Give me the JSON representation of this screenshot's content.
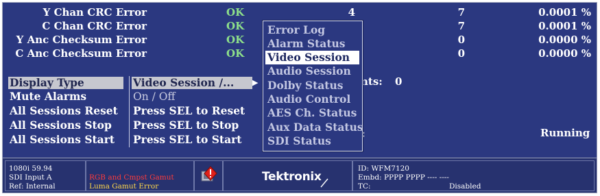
{
  "error_table": {
    "rows": [
      {
        "label": "Y Chan CRC Error",
        "status": "OK",
        "col1": "4",
        "col2": "7",
        "col3": "0.0001 %"
      },
      {
        "label": "C Chan CRC Error",
        "status": "OK",
        "col1": "",
        "col2": "7",
        "col3": "0.0001 %"
      },
      {
        "label": "Y Anc Checksum Error",
        "status": "OK",
        "col1": "",
        "col2": "0",
        "col3": "0.0000 %"
      },
      {
        "label": "C Anc Checksum Error",
        "status": "OK",
        "col1": "",
        "col2": "0",
        "col3": "0.0000 %"
      }
    ]
  },
  "menu": {
    "rows": [
      {
        "name": "Display Type",
        "value": "Video Session /..."
      },
      {
        "name": "Mute Alarms",
        "value": "On / Off"
      },
      {
        "name": "All Sessions Reset",
        "value": "Press SEL to Reset"
      },
      {
        "name": "All Sessions Stop",
        "value": "Press SEL to Stop"
      },
      {
        "name": "All Sessions Start",
        "value": "Press SEL to Start"
      }
    ],
    "submenu_arrow": "▶"
  },
  "popup": {
    "items": [
      "Error Log",
      "Alarm Status",
      "Video Session",
      "Audio Session",
      "Dolby Status",
      "Audio Control",
      "AES Ch. Status",
      "Aux Data Status",
      "SDI Status"
    ],
    "active_index": 2
  },
  "background_fragments": {
    "events_label": "nts:",
    "events_value": "0",
    "colon": ":",
    "session_state": "Running"
  },
  "status_bar": {
    "format": "1080i 59.94",
    "input": "SDI Input A",
    "ref": "Ref: Internal",
    "gamut_rgb": "RGB and Cmpst Gamut",
    "gamut_luma": "Luma Gamut Error",
    "brand": "Tektronix",
    "id": "ID: WFM7120",
    "embd": "Embd: PPPP PPPP ---- ----",
    "tc_label": "TC:",
    "tc_value": "Disabled"
  },
  "colors": {
    "background": "#2b3880",
    "ok_green": "#8ee08a",
    "error_red": "#ff3b3b",
    "warning_yellow": "#ffd84a"
  }
}
